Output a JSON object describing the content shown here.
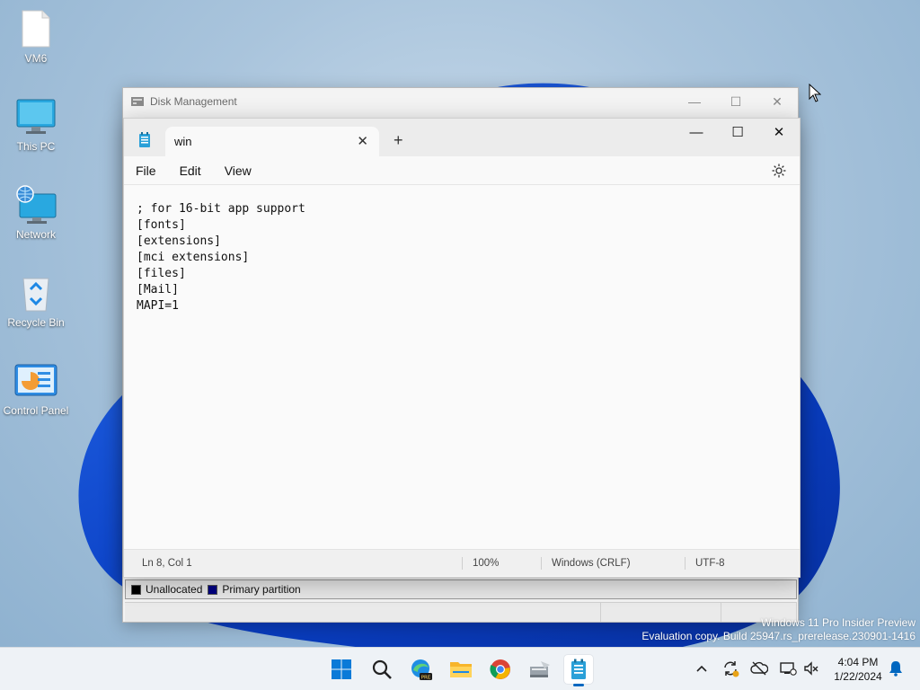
{
  "desktop": {
    "icons": [
      {
        "label": "VM6",
        "icon": "file-icon"
      },
      {
        "label": "This PC",
        "icon": "monitor-icon"
      },
      {
        "label": "Network",
        "icon": "network-icon"
      },
      {
        "label": "Recycle Bin",
        "icon": "recycle-bin-icon"
      },
      {
        "label": "Control Panel",
        "icon": "control-panel-icon"
      }
    ]
  },
  "disk_management": {
    "title": "Disk Management",
    "legend": {
      "unallocated_label": "Unallocated",
      "primary_label": "Primary partition",
      "unallocated_color": "#000000",
      "primary_color": "#000080"
    }
  },
  "notepad": {
    "tab_title": "win",
    "menu": {
      "file": "File",
      "edit": "Edit",
      "view": "View"
    },
    "content_lines": [
      "; for 16-bit app support",
      "[fonts]",
      "[extensions]",
      "[mci extensions]",
      "[files]",
      "[Mail]",
      "MAPI=1"
    ],
    "status": {
      "position": "Ln 8, Col 1",
      "zoom": "100%",
      "line_ending": "Windows (CRLF)",
      "encoding": "UTF-8"
    }
  },
  "watermark": {
    "line1": "Windows 11 Pro Insider Preview",
    "line2": "Evaluation copy. Build 25947.rs_prerelease.230901-1416"
  },
  "taskbar": {
    "apps": [
      "start-icon",
      "search-icon",
      "edge-preview-icon",
      "file-explorer-icon",
      "chrome-icon",
      "disk-management-icon",
      "notepad-icon"
    ],
    "clock": {
      "time": "4:04 PM",
      "date": "1/22/2024"
    },
    "accent_color": "#0067c0"
  }
}
